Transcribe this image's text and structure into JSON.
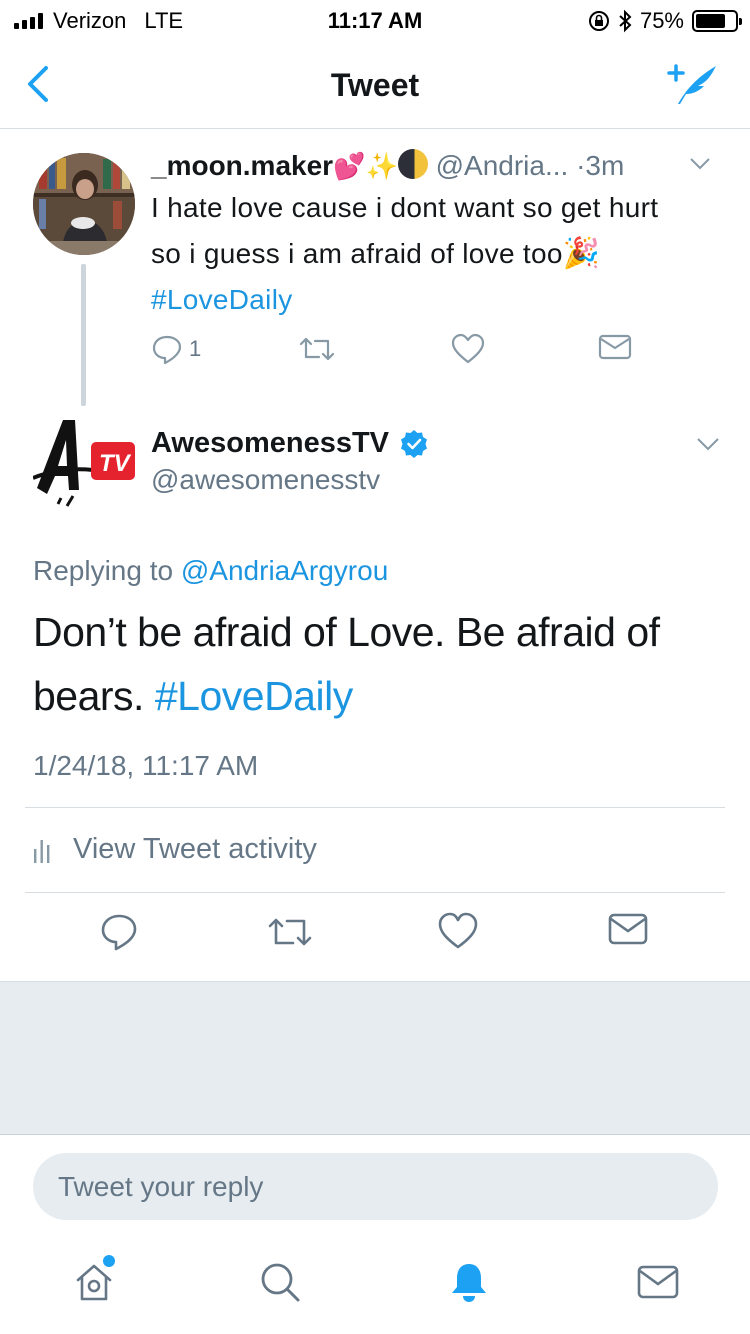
{
  "status_bar": {
    "carrier": "Verizon",
    "network": "LTE",
    "time": "11:17 AM",
    "battery_percent": "75%",
    "battery_level": 0.75
  },
  "nav": {
    "title": "Tweet",
    "back_icon": "chevron-left-icon",
    "compose_icon": "compose-tweet-icon"
  },
  "parent_tweet": {
    "name": "_moon.maker",
    "name_emojis": [
      "heart-emoji",
      "sparkles-emoji",
      "moon-emoji"
    ],
    "handle": "@Andria...",
    "separator": "·",
    "time": "3m",
    "text_line1": "I hate love cause i dont want so get hurt",
    "text_line2": "so i guess i am afraid of love too",
    "hashtag": "#LoveDaily",
    "reply_count": "1"
  },
  "main_tweet": {
    "name": "AwesomenessTV",
    "handle": "@awesomenesstv",
    "replying_prefix": "Replying to",
    "replying_to": "@AndriaArgyrou",
    "text": "Don’t be afraid of Love. Be afraid of bears.",
    "hashtag": "#LoveDaily",
    "timestamp": "1/24/18, 11:17 AM",
    "activity_label": "View Tweet activity"
  },
  "reply": {
    "placeholder": "Tweet your reply"
  },
  "tabs": [
    "home-icon",
    "search-icon",
    "notifications-icon",
    "messages-icon"
  ],
  "colors": {
    "accent": "#1da1f2",
    "link": "#1b95e0",
    "secondary_text": "#657786",
    "background_grey": "#e6ecf0"
  }
}
